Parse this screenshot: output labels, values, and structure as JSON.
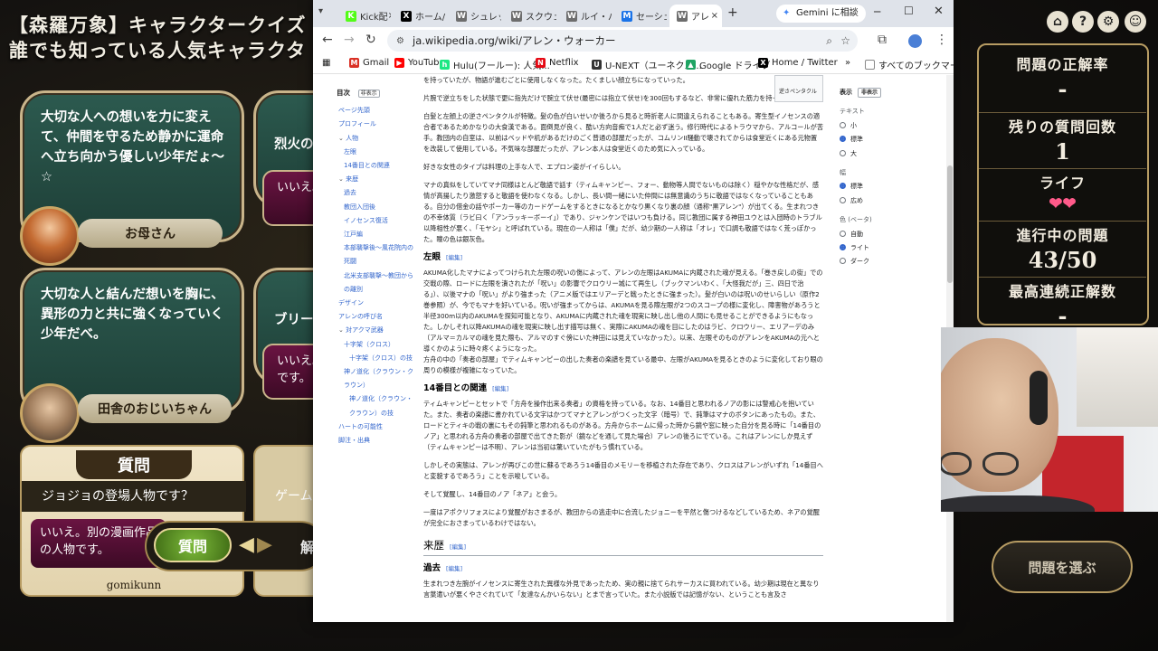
{
  "game": {
    "title_line1": "【森羅万象】キャラクタークイズ",
    "title_line2": "誰でも知っている人気キャラクタ",
    "bubbles": [
      {
        "text": "大切な人への想いを力に変えて、仲間を守るため静かに運命へ立ち向かう優しい少年だょ～☆"
      },
      {
        "text": "大切な人と結んだ想いを胸に、異形の力と共に強くなっていく少年だべ。"
      }
    ],
    "side_bubbles": [
      {
        "text": "烈火の"
      },
      {
        "text": "ブリー"
      }
    ],
    "side_answers": [
      {
        "text": "いいえ。"
      },
      {
        "text": "いいえ。\nです。"
      }
    ],
    "characters": [
      {
        "name": "お母さん"
      },
      {
        "name": "田舎のおじいちゃん"
      }
    ],
    "question_panel": {
      "title": "質問",
      "question": "ジョジョの登場人物です？",
      "answer": "いいえ。別の漫画作品の人物です。",
      "ask_button": "質問",
      "answer_button_partial": "解",
      "player": "gomikunn",
      "side_question_partial": "ゲーム"
    },
    "stats": {
      "correct_rate_label": "問題の正解率",
      "correct_rate_value": "-",
      "remaining_label": "残りの質問回数",
      "remaining_value": "1",
      "life_label": "ライフ",
      "life_value": "❤❤",
      "progress_label": "進行中の問題",
      "progress_value": "43/50",
      "streak_label": "最高連続正解数",
      "streak_value": "-",
      "choose_button": "問題を選ぶ"
    }
  },
  "browser": {
    "tabs": [
      {
        "label": "Kick配",
        "icon": "K"
      },
      {
        "label": "ホーム/",
        "icon": "X"
      },
      {
        "label": "シュレッ",
        "icon": "W"
      },
      {
        "label": "スクウェ",
        "icon": "W"
      },
      {
        "label": "ルイ・パ",
        "icon": "W"
      },
      {
        "label": "セーシェ",
        "icon": "M"
      },
      {
        "label": "アレ",
        "icon": "W"
      }
    ],
    "new_tab": "+",
    "gemini_button": "Gemini に相談",
    "url": "ja.wikipedia.org/wiki/アレン・ウォーカー",
    "bookmarks": [
      {
        "label": "Gmail",
        "color": "#d93025",
        "icon": "M"
      },
      {
        "label": "YouTube",
        "color": "#ff0000",
        "icon": "▶"
      },
      {
        "label": "Hulu(フールー): 人気...",
        "color": "#1ce783",
        "icon": "h"
      },
      {
        "label": "Netflix",
        "color": "#e50914",
        "icon": "N"
      },
      {
        "label": "U-NEXT（ユーネクス...",
        "color": "#333333",
        "icon": "U"
      },
      {
        "label": "Google ドライブ",
        "color": "#1fa463",
        "icon": "▲"
      },
      {
        "label": "Home / Twitter",
        "color": "#000000",
        "icon": "X"
      }
    ],
    "bookmarks_more": "»",
    "all_bookmarks": "すべてのブックマーク"
  },
  "wiki": {
    "toc_title": "目次",
    "toc_hide": "非表示",
    "toc": [
      {
        "text": "ページ先頭",
        "lvl": 1
      },
      {
        "text": "プロフィール",
        "lvl": 1
      },
      {
        "text": "人物",
        "lvl": 1,
        "exp": true
      },
      {
        "text": "左眼",
        "lvl": 2
      },
      {
        "text": "14番目との関連",
        "lvl": 2
      },
      {
        "text": "来歴",
        "lvl": 1,
        "exp": true
      },
      {
        "text": "過去",
        "lvl": 2
      },
      {
        "text": "教団入団後",
        "lvl": 2
      },
      {
        "text": "イノセンス復活",
        "lvl": 2
      },
      {
        "text": "江戸編",
        "lvl": 2
      },
      {
        "text": "本部襲撃後〜風花院内の死闘",
        "lvl": 2
      },
      {
        "text": "北米支部襲撃〜教団からの離別",
        "lvl": 2
      },
      {
        "text": "デザイン",
        "lvl": 1
      },
      {
        "text": "アレンの呼び名",
        "lvl": 1
      },
      {
        "text": "対アクマ武器",
        "lvl": 1,
        "exp": true
      },
      {
        "text": "十字架（クロス）",
        "lvl": 2
      },
      {
        "text": "十字架（クロス）の技",
        "lvl": 3
      },
      {
        "text": "神ノ道化（クラウン・クラウン）",
        "lvl": 2
      },
      {
        "text": "神ノ道化（クラウン・クラウン）の技",
        "lvl": 3
      },
      {
        "text": "ハートの可能性",
        "lvl": 1
      },
      {
        "text": "脚注・出典",
        "lvl": 1
      }
    ],
    "p0": "を持っていたが、物語が進むごとに使用しなくなった。たくましい顔立ちになっていった。",
    "p1": "片腕で逆立ちをした状態で更に指先だけで腕立て伏せ(最密には指立て伏せ)を300回もするなど、非常に優れた筋力を持っている。",
    "p2": "白髪と左顔上の逆さペンタクルが特徴。髪の色が白いせいか後ろから見ると時折老人に間違えられることもある。寄生型イノセンスの適合者であるためかなりの大食漢である。面倒見が良く、酷い方向音痴で1人だと必ず迷う。修行時代によるトラウマから、アルコールが苦手。教団内の自室は、以前はベッドや机があるだけのごく普通の部屋だったが、コムリンII騒動で壊されてからは食堂近くにある元物置を改装して使用している。不気味な部屋だったが、アレン本人は食堂近くのため気に入っている。",
    "p3": "好きな女性のタイプは料理の上手な人で、エプロン姿がイイらしい。",
    "p4": "マナの真似をしていてマナ同様はとんど敬語で話す（ティムキャンピー、フォー、動物等人間でないものは除く）穏やかな性格だが、感情が高揚したり激怒すると敬語を使わなくなる。しかし、長い間一緒にいた仲間には無意識のうちに敬語ではなくなっていることもある。自分の借金の話やポーカー等のカードゲームをするときになるとかなり黒くなり裏の顔（通称\"黒アレン\"）が出てくる。生まれつきの不幸体質（ラビ曰く「アンラッキーボーイ」）であり、ジャンケンではいつも負ける。同じ教団に属する神田ユウとは入団時のトラブル以降相性が悪く、「モヤシ」と呼ばれている。現在の一人称は「僕」だが、幼少期の一人称は「オレ」で口調も敬語ではなく荒っぽかった。瞳の色は銀灰色。",
    "s1": "左眼",
    "p5": "AKUMA化したマナによってつけられた左眼の呪いの傷によって、アレンの左眼はAKUMAに内蔵された魂が見える。「巻き戻しの街」での交戦の際、ロードに左眼を潰されたが「呪い」の影響でクロウリー城にて再生し（ブックマンいわく、「大怪我だが」三、四日で治る」）、以後マナの「呪い」がより強まった（アニメ版ではエリアーデと戦ったときに強まった）。髪が白いのは呪いのせいらしい（原作2巻参照）が、今でもマナを好いている。呪いが強まってからは、AKUMAを見る際左眼が2つのスコープの様に変化し、障害物があろうと半径300m以内のAKUMAを探知可能となり、AKUMAに内蔵された魂を現実に映し出し他の人間にも見せることができるようにもなった。しかしそれ以降AKUMAの魂を現実に映し出す描写は無く、実際にAKUMAの魂を目にしたのはラビ、クロウリー、エリアーデのみ（アルマ＝カルマの魂を見た際も、アルマのすぐ傍にいた神田には見えていなかった）。以来、左眼そのものがアレンをAKUMAの元へと導くかのように時々疼くようになった。",
    "p6": "方舟の中の「奏者の部屋」でティムキャンピーの出した奏者の楽譜を見ている最中、左眼がAKUMAを見るときのように変化しており眼の周りの模様が複雑になっていた。",
    "s2": "14番目との関連",
    "p7": "ティムキャンピーとセットで「方舟を操作出来る奏者」の資格を持っている。なお、14番目と思われるノアの影には警戒心を抱いていた。また、奏者の楽譜に書かれている文字はかつてマナとアレンがつくった文字（暗号）で、鈍筆はマナのボタンにあったもの。また、ロードとティキの戦の裏にもその鈍筆と思われるものがある。方舟からホームに帰った時から鏡や窓に映った自分を見る時に「14番目のノア」と思われる方舟の奏者の部屋で出てきた影が（鏡などを通して見た場合）アレンの後ろにでている。これはアレンにしか見えず（ティムキャンピーは不明）、アレンは当初は驚いていたがもう慣れている。",
    "p8": "しかしその実態は、アレンが再びこの世に蘇るであろう14番目のメモリーを移植された存在であり、クロスはアレンがいずれ「14番目へと変貌するであろう」ことを示唆している。",
    "p9": "そして覚醒し、14番目のノア「ネア」と会う。",
    "p10": "一度はアポクリフォスにより覚醒がおさまるが、教団からの逃走中に合流したジョニーを平然と傷つけるなどしているため、ネアの覚醒が完全におさまっているわけではない。",
    "h2": "来歴",
    "s3": "過去",
    "p11": "生まれつき左腕がイノセンスに寄生された異様な外見であったため、実の親に捨てられサーカスに買われている。幼少期は現在と異なり言葉遣いが悪くやさぐれていて「友達なんかいらない」とまで言っていた。また小説版では記憶がない、ということも言及さ",
    "edit": "[編集]",
    "infobox_note": "逆さペンタクル",
    "appearance": {
      "title": "表示",
      "hide": "非表示",
      "text_label": "テキスト",
      "text_options": [
        "小",
        "標準",
        "大"
      ],
      "text_selected": 1,
      "width_label": "幅",
      "width_options": [
        "標準",
        "広め"
      ],
      "width_selected": 0,
      "color_label": "色 (ベータ)",
      "color_options": [
        "自動",
        "ライト",
        "ダーク"
      ],
      "color_selected": 1
    }
  }
}
